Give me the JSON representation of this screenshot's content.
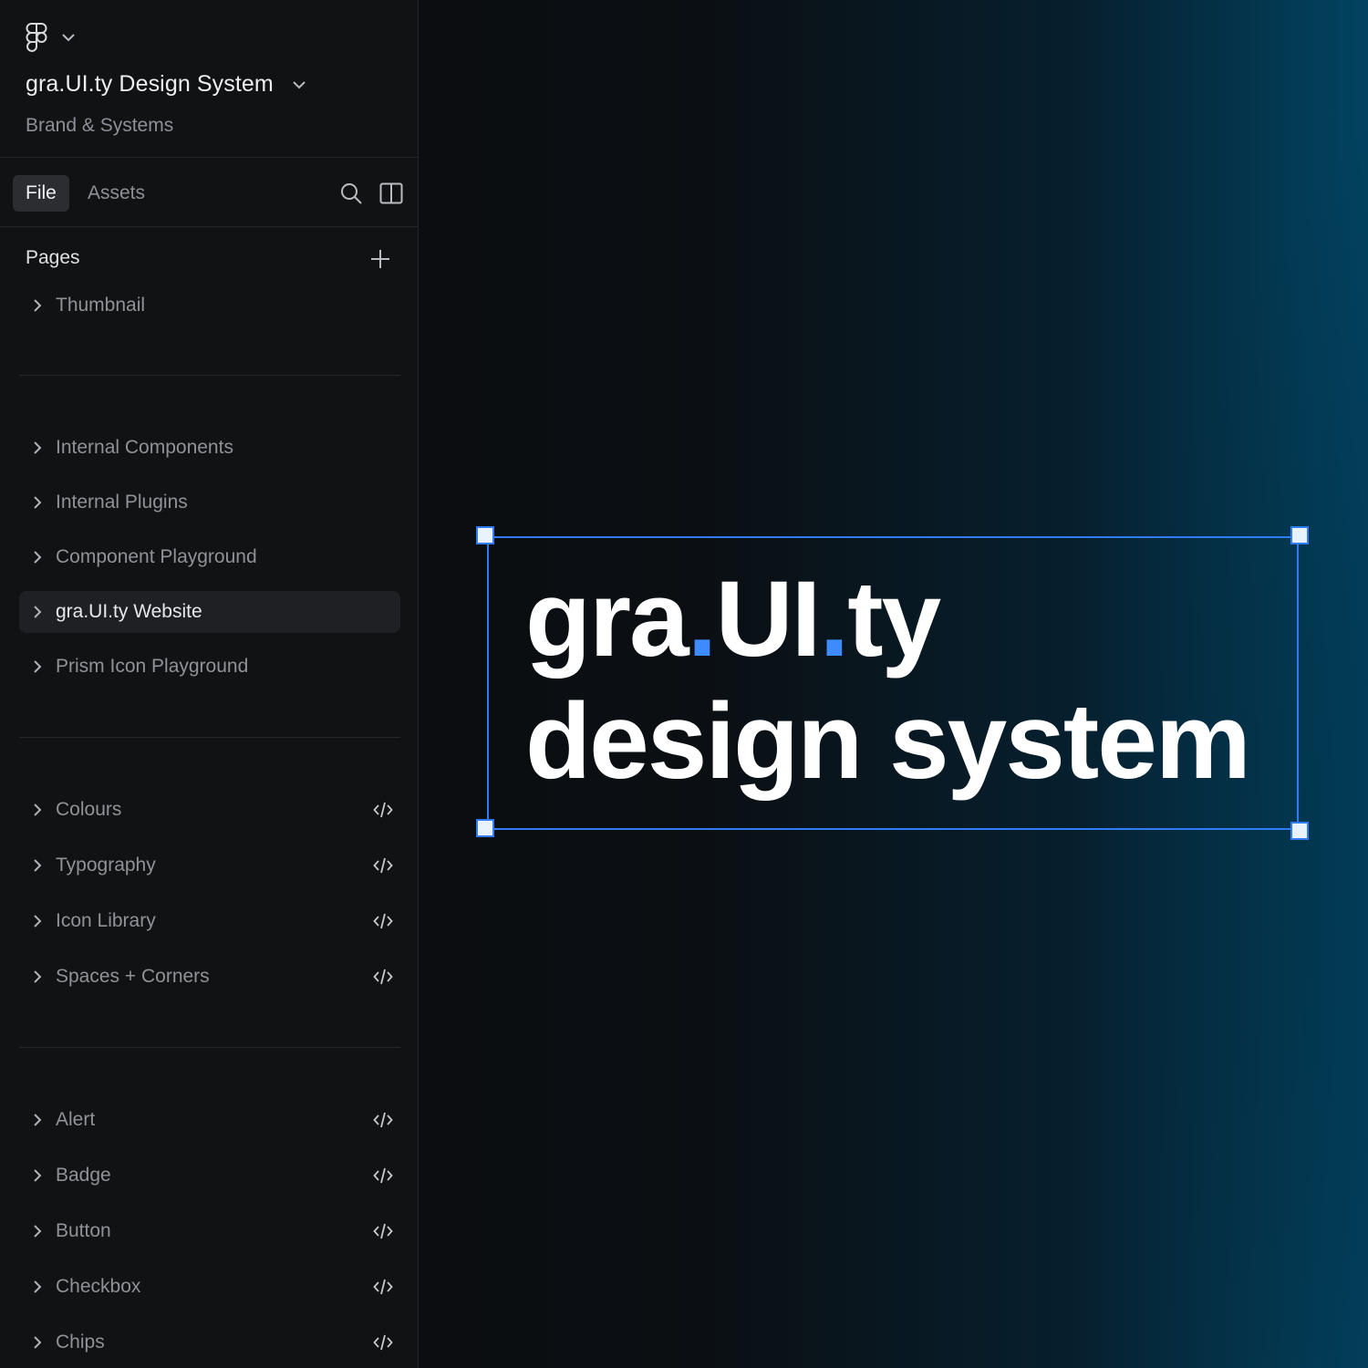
{
  "header": {
    "project_title": "gra.UI.ty Design System",
    "project_subtitle": "Brand & Systems"
  },
  "tabs": {
    "file": "File",
    "assets": "Assets"
  },
  "pages": {
    "title": "Pages",
    "groups": [
      {
        "items": [
          {
            "label": "Thumbnail",
            "code": false
          }
        ]
      },
      {
        "items": [
          {
            "label": "Internal Components",
            "code": false
          },
          {
            "label": "Internal Plugins",
            "code": false
          },
          {
            "label": "Component Playground",
            "code": false
          },
          {
            "label": "gra.UI.ty Website",
            "code": false,
            "selected": true
          },
          {
            "label": "Prism Icon Playground",
            "code": false
          }
        ]
      },
      {
        "items": [
          {
            "label": "Colours",
            "code": true
          },
          {
            "label": "Typography",
            "code": true
          },
          {
            "label": "Icon Library",
            "code": true
          },
          {
            "label": "Spaces + Corners",
            "code": true
          }
        ]
      },
      {
        "items": [
          {
            "label": "Alert",
            "code": true
          },
          {
            "label": "Badge",
            "code": true
          },
          {
            "label": "Button",
            "code": true
          },
          {
            "label": "Checkbox",
            "code": true
          },
          {
            "label": "Chips",
            "code": true
          }
        ]
      }
    ]
  },
  "canvas": {
    "hero_line1_a": "gra",
    "hero_line1_dot1": ".",
    "hero_line1_b": "UI",
    "hero_line1_dot2": ".",
    "hero_line1_c": "ty",
    "hero_line2": "design system",
    "accent_color": "#3d8bff",
    "selection_color": "#2f7cf6"
  }
}
